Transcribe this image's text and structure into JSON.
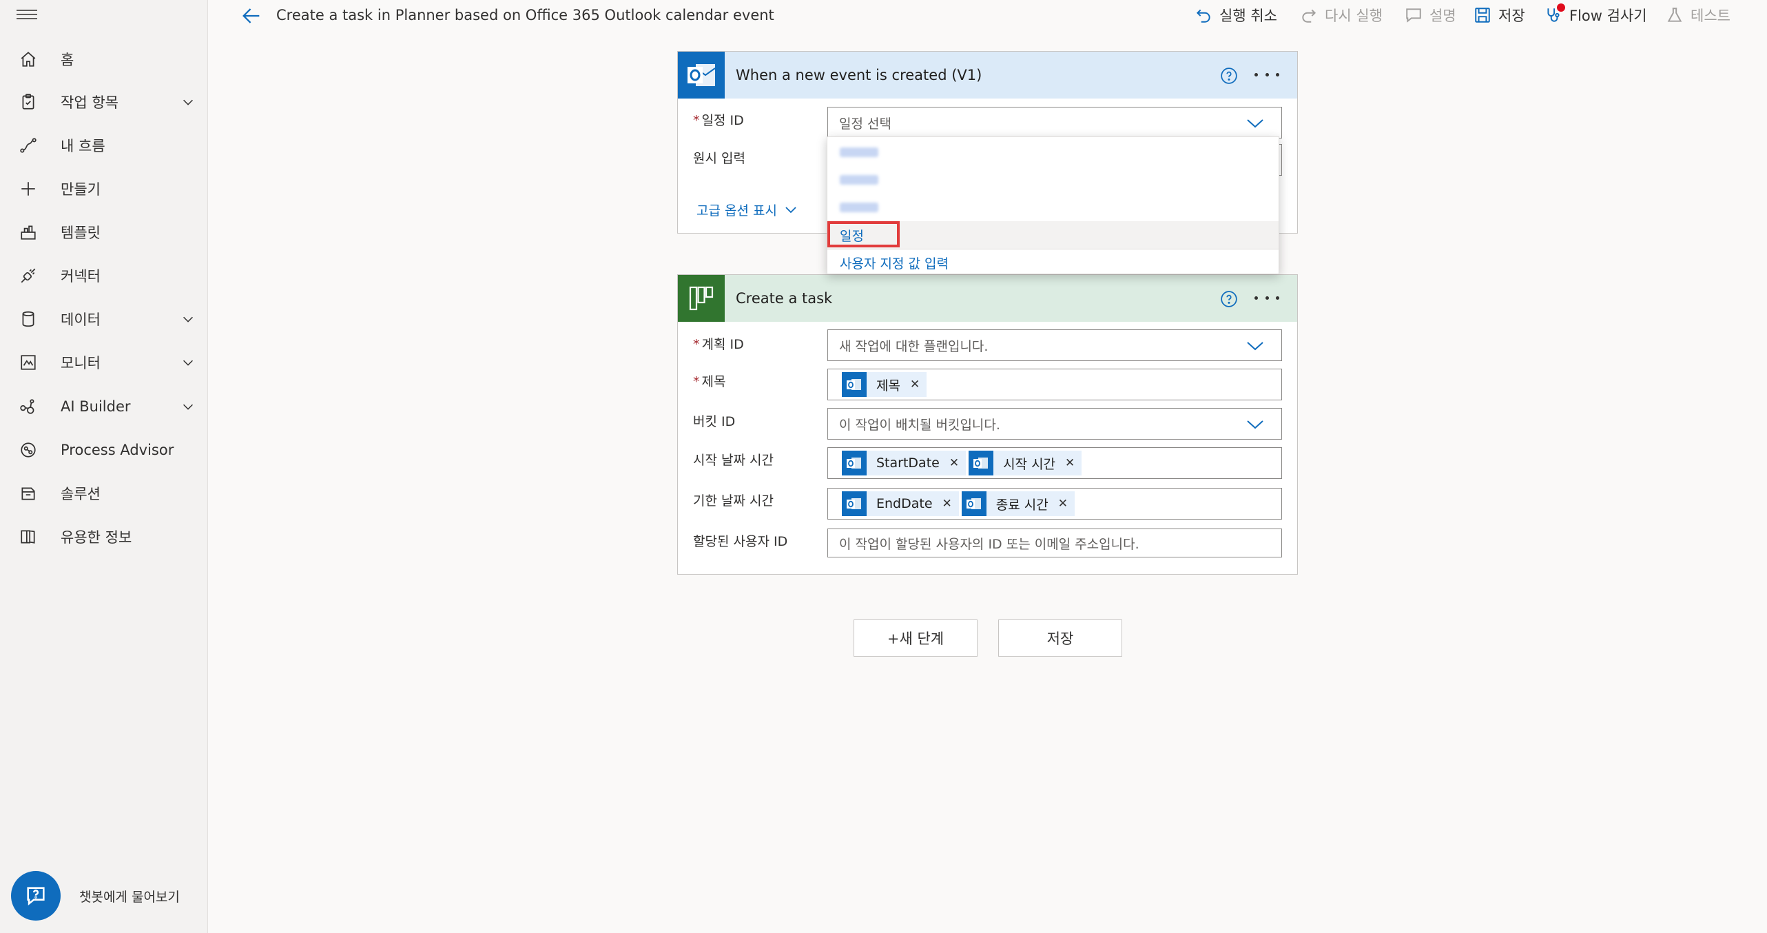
{
  "sidebar": {
    "items": [
      {
        "label": "홈",
        "icon": "home-icon"
      },
      {
        "label": "작업 항목",
        "icon": "clipboard-icon",
        "expandable": true
      },
      {
        "label": "내 흐름",
        "icon": "flow-icon"
      },
      {
        "label": "만들기",
        "icon": "plus-icon"
      },
      {
        "label": "템플릿",
        "icon": "template-icon"
      },
      {
        "label": "커넥터",
        "icon": "connector-icon"
      },
      {
        "label": "데이터",
        "icon": "database-icon",
        "expandable": true
      },
      {
        "label": "모니터",
        "icon": "monitor-icon",
        "expandable": true
      },
      {
        "label": "AI Builder",
        "icon": "ai-builder-icon",
        "expandable": true
      },
      {
        "label": "Process Advisor",
        "icon": "process-advisor-icon"
      },
      {
        "label": "솔루션",
        "icon": "solutions-icon"
      },
      {
        "label": "유용한 정보",
        "icon": "book-icon"
      }
    ],
    "chatbot_label": "챗봇에게 물어보기"
  },
  "topbar": {
    "title": "Create a task in Planner based on Office 365 Outlook calendar event",
    "undo": "실행 취소",
    "redo": "다시 실행",
    "comment": "설명",
    "save": "저장",
    "flow_checker": "Flow 검사기",
    "test": "테스트"
  },
  "trigger_card": {
    "title": "When a new event is created (V1)",
    "calendar_id_label": "일정 ID",
    "calendar_id_placeholder": "일정 선택",
    "raw_input_label": "원시 입력",
    "advanced_link": "고급 옵션 표시"
  },
  "dropdown": {
    "highlighted_option": "일정",
    "custom_value_option": "사용자 지정 값 입력"
  },
  "action_card": {
    "title": "Create a task",
    "plan_id_label": "계획 ID",
    "plan_id_placeholder": "새 작업에 대한 플랜입니다.",
    "subject_label": "제목",
    "subject_tokens": [
      "제목"
    ],
    "bucket_id_label": "버킷 ID",
    "bucket_id_placeholder": "이 작업이 배치될 버킷입니다.",
    "start_label": "시작 날짜 시간",
    "start_tokens": [
      "StartDate",
      "시작 시간"
    ],
    "due_label": "기한 날짜 시간",
    "due_tokens": [
      "EndDate",
      "종료 시간"
    ],
    "assigned_label": "할당된 사용자 ID",
    "assigned_placeholder": "이 작업이 할당된 사용자의 ID 또는 이메일 주소입니다."
  },
  "actions": {
    "new_step": "+새 단계",
    "save": "저장"
  },
  "colors": {
    "accent": "#0f6cbd",
    "outlook_tile": "#0f6cbd",
    "planner_tile": "#31752f",
    "trigger_header": "#dbeaf8",
    "action_header": "#dcece2",
    "highlight_border": "#e13c3c"
  }
}
